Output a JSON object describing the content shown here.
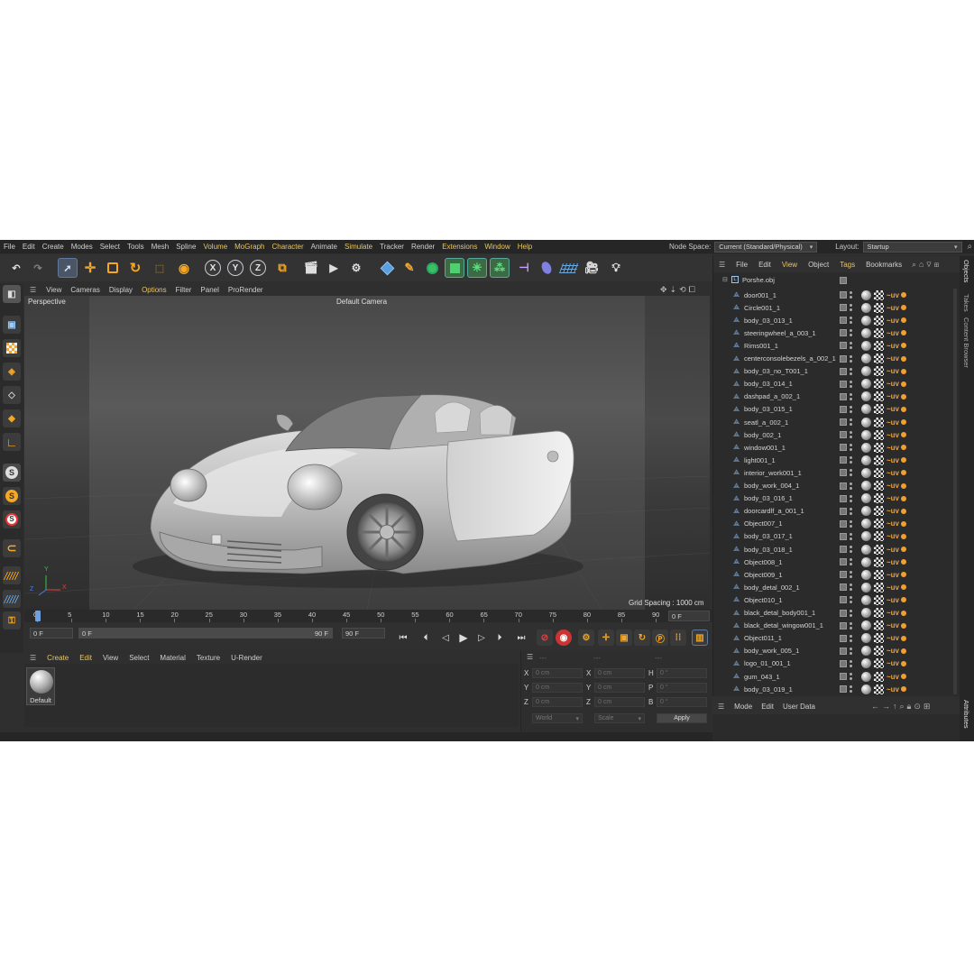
{
  "menu": {
    "items": [
      {
        "label": "File",
        "hl": false
      },
      {
        "label": "Edit",
        "hl": false
      },
      {
        "label": "Create",
        "hl": false
      },
      {
        "label": "Modes",
        "hl": false
      },
      {
        "label": "Select",
        "hl": false
      },
      {
        "label": "Tools",
        "hl": false
      },
      {
        "label": "Mesh",
        "hl": false
      },
      {
        "label": "Spline",
        "hl": false
      },
      {
        "label": "Volume",
        "hl": true
      },
      {
        "label": "MoGraph",
        "hl": true
      },
      {
        "label": "Character",
        "hl": true
      },
      {
        "label": "Animate",
        "hl": false
      },
      {
        "label": "Simulate",
        "hl": true
      },
      {
        "label": "Tracker",
        "hl": false
      },
      {
        "label": "Render",
        "hl": false
      },
      {
        "label": "Extensions",
        "hl": true
      },
      {
        "label": "Window",
        "hl": true
      },
      {
        "label": "Help",
        "hl": true
      }
    ],
    "node_space_label": "Node Space:",
    "node_space_value": "Current (Standard/Physical)",
    "layout_label": "Layout:",
    "layout_value": "Startup"
  },
  "toolbar": {
    "axis_x": "X",
    "axis_y": "Y",
    "axis_z": "Z"
  },
  "viewport": {
    "menu": [
      "View",
      "Cameras",
      "Display",
      "Options",
      "Filter",
      "Panel",
      "ProRender"
    ],
    "menu_highlight": "Options",
    "view_name": "Perspective",
    "camera": "Default Camera",
    "grid_spacing": "Grid Spacing : 1000 cm",
    "axis_x": "X",
    "axis_y": "Y",
    "axis_z": "Z"
  },
  "timeline": {
    "ticks": [
      "0",
      "5",
      "10",
      "15",
      "20",
      "25",
      "30",
      "35",
      "40",
      "45",
      "50",
      "55",
      "60",
      "65",
      "70",
      "75",
      "80",
      "85",
      "90"
    ],
    "current_frame": "0 F",
    "start": "0 F",
    "range_start": "0 F",
    "range_end": "90 F",
    "end": "90 F"
  },
  "materials": {
    "menu": [
      "Create",
      "Edit",
      "View",
      "Select",
      "Material",
      "Texture",
      "U-Render"
    ],
    "highlight": [
      "Create",
      "Edit"
    ],
    "items": [
      {
        "name": "Default"
      }
    ]
  },
  "coordinates": {
    "x": "X",
    "y": "Y",
    "z": "Z",
    "h": "H",
    "p": "P",
    "b": "B",
    "pos": "0 cm",
    "angle": "0 °",
    "mode1": "World",
    "mode2": "Scale",
    "apply": "Apply",
    "dash": "---"
  },
  "objects": {
    "menu": [
      "File",
      "Edit",
      "View",
      "Object",
      "Tags",
      "Bookmarks"
    ],
    "menu_highlight": [
      "View",
      "Tags"
    ],
    "root": "Porshe.obj",
    "items": [
      "door001_1",
      "Circle001_1",
      "body_03_013_1",
      "steeringwheel_a_003_1",
      "Rims001_1",
      "centerconsolebezels_a_002_1",
      "body_03_no_T001_1",
      "body_03_014_1",
      "dashpad_a_002_1",
      "body_03_015_1",
      "seatl_a_002_1",
      "body_002_1",
      "window001_1",
      "light001_1",
      "interior_work001_1",
      "body_work_004_1",
      "body_03_016_1",
      "doorcardlf_a_001_1",
      "Object007_1",
      "body_03_017_1",
      "body_03_018_1",
      "Object008_1",
      "Object009_1",
      "body_detal_002_1",
      "Object010_1",
      "black_detal_body001_1",
      "black_detal_wingow001_1",
      "Object011_1",
      "body_work_005_1",
      "logo_01_001_1",
      "gum_043_1",
      "body_03_019_1"
    ]
  },
  "attributes": {
    "menu": [
      "Mode",
      "Edit",
      "User Data"
    ]
  },
  "side_tabs": [
    "Objects",
    "Takes",
    "Content Browser",
    "Attributes"
  ]
}
